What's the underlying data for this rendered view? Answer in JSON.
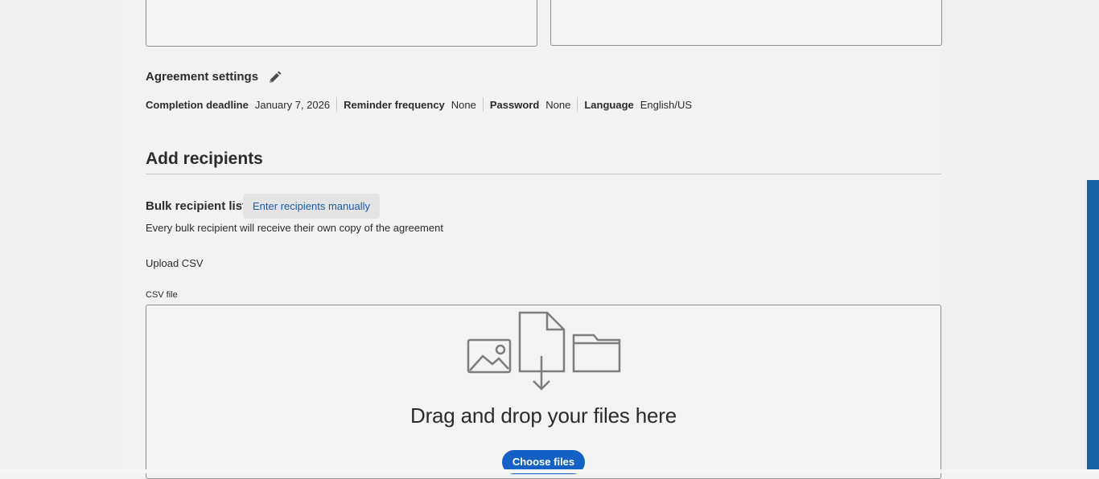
{
  "agreement_settings": {
    "title": "Agreement settings",
    "edit_icon": "pencil-icon",
    "items": [
      {
        "key": "Completion deadline",
        "value": "January 7, 2026"
      },
      {
        "key": "Reminder frequency",
        "value": "None"
      },
      {
        "key": "Password",
        "value": "None"
      },
      {
        "key": "Language",
        "value": "English/US"
      }
    ]
  },
  "recipients": {
    "title": "Add recipients",
    "bulk_label": "Bulk recipient list",
    "manual_button": "Enter recipients manually",
    "description": "Every bulk recipient will receive their own copy of the agreement"
  },
  "upload": {
    "label": "Upload CSV",
    "csv_label": "CSV file",
    "drop_text": "Drag and drop your files here",
    "choose_button": "Choose files",
    "icons": [
      "image-icon",
      "file-download-icon",
      "folder-icon"
    ]
  },
  "colors": {
    "accent": "#1460c4",
    "link": "#1a5aa8",
    "scrollbar": "#1862a8"
  }
}
